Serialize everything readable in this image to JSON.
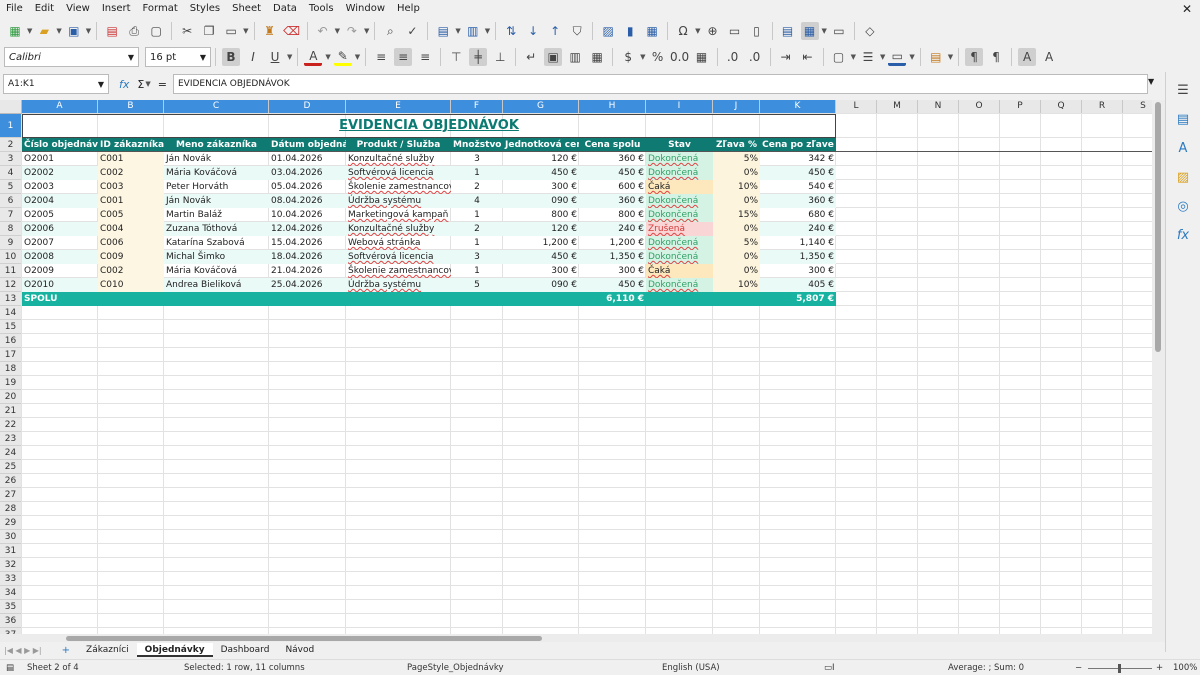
{
  "menu": [
    "File",
    "Edit",
    "View",
    "Insert",
    "Format",
    "Styles",
    "Sheet",
    "Data",
    "Tools",
    "Window",
    "Help"
  ],
  "font": {
    "name": "Calibri",
    "size": "16 pt"
  },
  "formula": {
    "cell_ref": "A1:K1",
    "content": "EVIDENCIA OBJEDNÁVOK"
  },
  "columns": [
    "A",
    "B",
    "C",
    "D",
    "E",
    "F",
    "G",
    "H",
    "I",
    "J",
    "K",
    "L",
    "M",
    "N",
    "O",
    "P",
    "Q",
    "R",
    "S"
  ],
  "sheet": {
    "title": "EVIDENCIA OBJEDNÁVOK",
    "headers": [
      "Číslo objednávky",
      "ID zákazníka",
      "Meno zákazníka",
      "Dátum objednávky",
      "Produkt / Služba",
      "Množstvo",
      "Jednotková cena",
      "Cena spolu",
      "Stav",
      "Zľava %",
      "Cena po zľave"
    ],
    "rows": [
      [
        "O2001",
        "C001",
        "Ján Novák",
        "01.04.2026",
        "Konzultačné služby",
        "3",
        "120 €",
        "360 €",
        "Dokončená",
        "5%",
        "342 €"
      ],
      [
        "O2002",
        "C002",
        "Mária Kováčová",
        "03.04.2026",
        "Softvérová licencia",
        "1",
        "450 €",
        "450 €",
        "Dokončená",
        "0%",
        "450 €"
      ],
      [
        "O2003",
        "C003",
        "Peter Horváth",
        "05.04.2026",
        "Školenie zamestnancov",
        "2",
        "300 €",
        "600 €",
        "Čaká",
        "10%",
        "540 €"
      ],
      [
        "O2004",
        "C001",
        "Ján Novák",
        "08.04.2026",
        "Údržba systému",
        "4",
        "090 €",
        "360 €",
        "Dokončená",
        "0%",
        "360 €"
      ],
      [
        "O2005",
        "C005",
        "Martin Baláž",
        "10.04.2026",
        "Marketingová kampaň",
        "1",
        "800 €",
        "800 €",
        "Dokončená",
        "15%",
        "680 €"
      ],
      [
        "O2006",
        "C004",
        "Zuzana Tóthová",
        "12.04.2026",
        "Konzultačné služby",
        "2",
        "120 €",
        "240 €",
        "Zrušená",
        "0%",
        "240 €"
      ],
      [
        "O2007",
        "C006",
        "Katarína Szabová",
        "15.04.2026",
        "Webová stránka",
        "1",
        "1,200 €",
        "1,200 €",
        "Dokončená",
        "5%",
        "1,140 €"
      ],
      [
        "O2008",
        "C009",
        "Michal Šimko",
        "18.04.2026",
        "Softvérová licencia",
        "3",
        "450 €",
        "1,350 €",
        "Dokončená",
        "0%",
        "1,350 €"
      ],
      [
        "O2009",
        "C002",
        "Mária Kováčová",
        "21.04.2026",
        "Školenie zamestnancov",
        "1",
        "300 €",
        "300 €",
        "Čaká",
        "0%",
        "300 €"
      ],
      [
        "O2010",
        "C010",
        "Andrea Bieliková",
        "25.04.2026",
        "Údržba systému",
        "5",
        "090 €",
        "450 €",
        "Dokončená",
        "10%",
        "405 €"
      ]
    ],
    "total": {
      "label": "SPOLU",
      "cena_spolu": "6,110 €",
      "cena_po_zlave": "5,807 €"
    },
    "row_count": 37
  },
  "tabs": [
    "Zákazníci",
    "Objednávky",
    "Dashboard",
    "Návod"
  ],
  "active_tab": "Objednávky",
  "status": {
    "sheet": "Sheet 2 of 4",
    "selection": "Selected: 1 row, 11 columns",
    "page_style": "PageStyle_Objednávky",
    "language": "English (USA)",
    "summary": "Average: ; Sum: 0",
    "zoom": "100%"
  }
}
